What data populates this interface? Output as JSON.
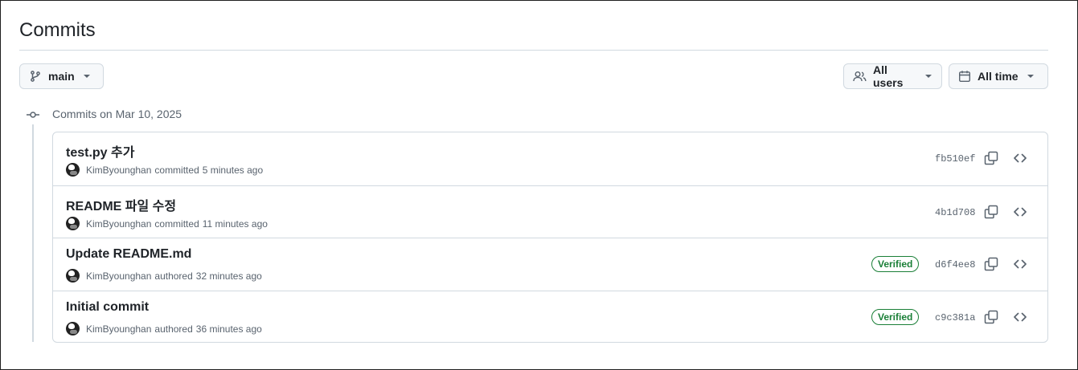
{
  "page": {
    "title": "Commits"
  },
  "filters": {
    "branch": {
      "label": "main",
      "icon": "git-branch-icon"
    },
    "users": {
      "label": "All users",
      "icon": "people-icon"
    },
    "time": {
      "label": "All time",
      "icon": "calendar-icon"
    }
  },
  "group": {
    "heading": "Commits on Mar 10, 2025"
  },
  "commits": [
    {
      "message": "test.py 추가",
      "author": "KimByounghan",
      "action": "committed",
      "time": "5 minutes ago",
      "verified": "",
      "sha": "fb510ef"
    },
    {
      "message": "README 파일 수정",
      "author": "KimByounghan",
      "action": "committed",
      "time": "11 minutes ago",
      "verified": "",
      "sha": "4b1d708"
    },
    {
      "message": "Update README.md",
      "author": "KimByounghan",
      "action": "authored",
      "time": "32 minutes ago",
      "verified": "Verified",
      "sha": "d6f4ee8"
    },
    {
      "message": "Initial commit",
      "author": "KimByounghan",
      "action": "authored",
      "time": "36 minutes ago",
      "verified": "Verified",
      "sha": "c9c381a"
    }
  ],
  "colors": {
    "verified": "#1a7f37",
    "border": "#d1d9e0",
    "muted": "#59636e"
  }
}
